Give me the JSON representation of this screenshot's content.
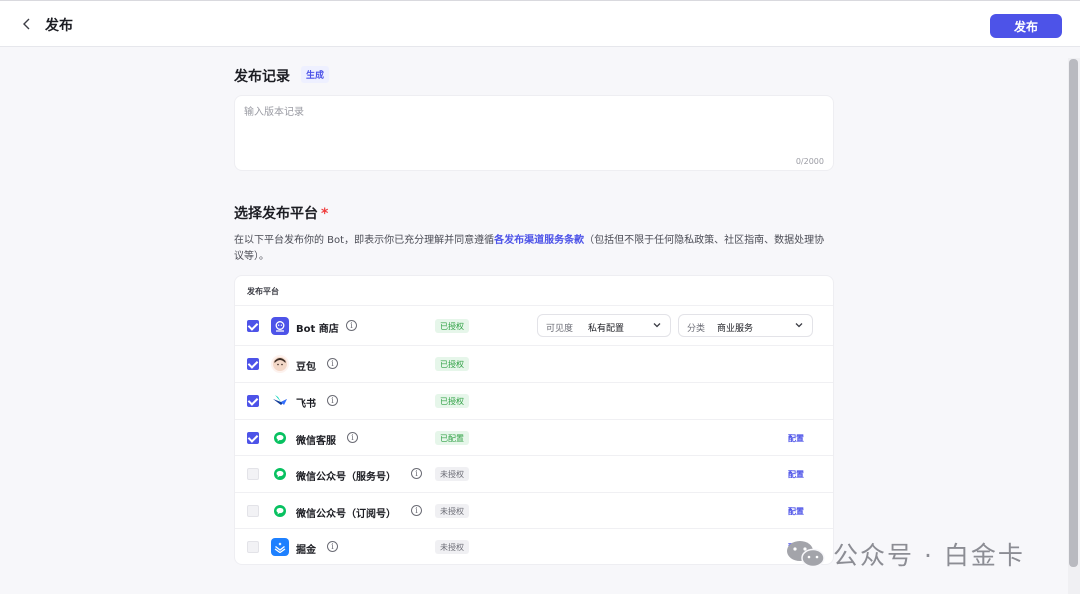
{
  "header": {
    "title": "发布",
    "publish_label": "发布"
  },
  "release_notes": {
    "title": "发布记录",
    "generate_label": "生成",
    "placeholder": "输入版本记录",
    "counter": "0/2000"
  },
  "platform_section": {
    "title": "选择发布平台",
    "required_mark": "*",
    "desc_prefix": "在以下平台发布你的 Bot，即表示你已充分理解并同意遵循",
    "desc_link": "各发布渠道服务条款",
    "desc_suffix": "（包括但不限于任何隐私政策、社区指南、数据处理协议等）。",
    "table_header": "发布平台"
  },
  "platforms": [
    {
      "name": "Bot 商店",
      "checked": true,
      "status": "已授权",
      "status_type": "ok",
      "icon": "bot-store-icon",
      "visibility_label": "可见度",
      "visibility_value": "私有配置",
      "category_label": "分类",
      "category_value": "商业服务"
    },
    {
      "name": "豆包",
      "checked": true,
      "status": "已授权",
      "status_type": "ok",
      "icon": "doubao-icon"
    },
    {
      "name": "飞书",
      "checked": true,
      "status": "已授权",
      "status_type": "ok",
      "icon": "feishu-icon"
    },
    {
      "name": "微信客服",
      "checked": true,
      "status": "已配置",
      "status_type": "ok",
      "icon": "wechat-icon",
      "action": "配置"
    },
    {
      "name": "微信公众号（服务号）",
      "checked": false,
      "status": "未授权",
      "status_type": "no",
      "icon": "wechat-icon",
      "action": "配置"
    },
    {
      "name": "微信公众号（订阅号）",
      "checked": false,
      "status": "未授权",
      "status_type": "no",
      "icon": "wechat-icon",
      "action": "配置"
    },
    {
      "name": "掘金",
      "checked": false,
      "status": "未授权",
      "status_type": "no",
      "icon": "juejin-icon",
      "action": "配置"
    }
  ],
  "watermark": "公众号 · 白金卡",
  "colors": {
    "accent": "#4d53e8",
    "ok_bg": "#e6f6ea",
    "ok_text": "#2ea043",
    "wechat_green": "#07c160"
  }
}
